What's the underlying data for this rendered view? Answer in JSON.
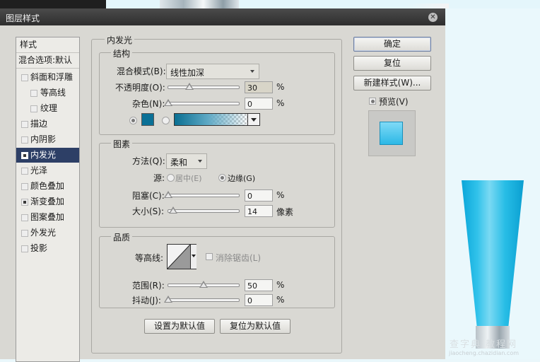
{
  "dialog": {
    "title": "图层样式"
  },
  "sidebar": {
    "items": [
      {
        "label": "样式",
        "checkbox": false,
        "checked": false,
        "selected": false
      },
      {
        "label": "混合选项:默认",
        "checkbox": false,
        "checked": false,
        "selected": false
      },
      {
        "label": "斜面和浮雕",
        "checkbox": true,
        "checked": false,
        "selected": false
      },
      {
        "label": "等高线",
        "checkbox": true,
        "checked": false,
        "selected": false
      },
      {
        "label": "纹理",
        "checkbox": true,
        "checked": false,
        "selected": false
      },
      {
        "label": "描边",
        "checkbox": true,
        "checked": false,
        "selected": false
      },
      {
        "label": "内阴影",
        "checkbox": true,
        "checked": false,
        "selected": false
      },
      {
        "label": "内发光",
        "checkbox": true,
        "checked": true,
        "selected": true
      },
      {
        "label": "光泽",
        "checkbox": true,
        "checked": false,
        "selected": false
      },
      {
        "label": "颜色叠加",
        "checkbox": true,
        "checked": false,
        "selected": false
      },
      {
        "label": "渐变叠加",
        "checkbox": true,
        "checked": true,
        "selected": false
      },
      {
        "label": "图案叠加",
        "checkbox": true,
        "checked": false,
        "selected": false
      },
      {
        "label": "外发光",
        "checkbox": true,
        "checked": false,
        "selected": false
      },
      {
        "label": "投影",
        "checkbox": true,
        "checked": false,
        "selected": false
      }
    ]
  },
  "panel": {
    "title": "内发光",
    "structure": {
      "title": "结构",
      "blend_mode_label": "混合模式(B):",
      "blend_mode_value": "线性加深",
      "opacity_label": "不透明度(O):",
      "opacity_value": "30",
      "opacity_unit": "%",
      "noise_label": "杂色(N):",
      "noise_value": "0",
      "noise_unit": "%",
      "glow_color": "#0a7096"
    },
    "elements": {
      "title": "图素",
      "technique_label": "方法(Q):",
      "technique_value": "柔和",
      "source_label": "源:",
      "source_center": "居中(E)",
      "source_edge": "边缘(G)",
      "choke_label": "阻塞(C):",
      "choke_value": "0",
      "choke_unit": "%",
      "size_label": "大小(S):",
      "size_value": "14",
      "size_unit": "像素"
    },
    "quality": {
      "title": "品质",
      "contour_label": "等高线:",
      "antialias_label": "消除锯齿(L)",
      "range_label": "范围(R):",
      "range_value": "50",
      "range_unit": "%",
      "jitter_label": "抖动(J):",
      "jitter_value": "0",
      "jitter_unit": "%"
    },
    "make_default": "设置为默认值",
    "reset_default": "复位为默认值"
  },
  "right": {
    "ok": "确定",
    "reset": "复位",
    "new_style": "新建样式(W)...",
    "preview_label": "预览(V)",
    "preview_checked": true
  },
  "sliders": {
    "opacity": 0.3,
    "noise": 0.0,
    "choke": 0.0,
    "size": 0.07,
    "range": 0.5,
    "jitter": 0.0
  },
  "watermark": {
    "line1": "查字典 教程网",
    "line2": "jiaocheng.chazidian.com"
  }
}
